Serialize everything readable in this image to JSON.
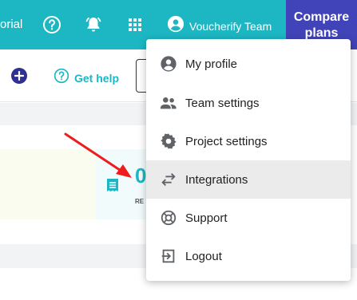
{
  "topbar": {
    "tutorial_partial": "orial",
    "help_icon": "help-circle-icon",
    "notifications_icon": "bell-icon",
    "apps_icon": "grid-icon",
    "user_name": "Voucherify Team",
    "compare_plans": "Compare plans",
    "accent_color": "#1cb7c3",
    "compare_color": "#4144b8"
  },
  "subbar": {
    "help_label": "Get help"
  },
  "dashboard": {
    "card_value_partial": "0",
    "card_label_partial": "RE"
  },
  "user_menu": {
    "items": [
      {
        "label": "My profile",
        "icon": "account-circle-icon"
      },
      {
        "label": "Team settings",
        "icon": "people-icon"
      },
      {
        "label": "Project settings",
        "icon": "gear-icon"
      },
      {
        "label": "Integrations",
        "icon": "swap-arrows-icon",
        "highlighted": true
      },
      {
        "label": "Support",
        "icon": "lifebuoy-icon"
      },
      {
        "label": "Logout",
        "icon": "logout-icon"
      }
    ]
  }
}
